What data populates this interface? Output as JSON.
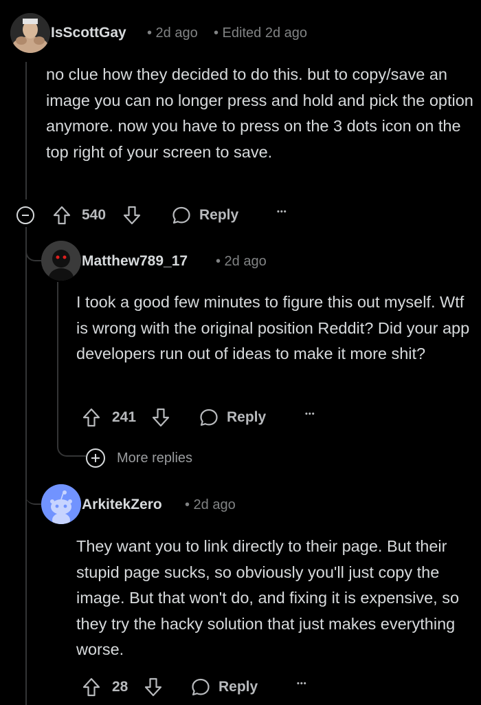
{
  "comments": [
    {
      "username": "IsScottGay",
      "age": "• 2d ago",
      "edited": "• Edited 2d ago",
      "body": "no clue how they decided to do this. but to copy/save an image you can no longer press and hold and pick the option anymore. now you have to press on the 3 dots icon on the top right of your screen to save.",
      "votes": "540",
      "reply_label": "Reply",
      "more_label": "•••"
    },
    {
      "username": "Matthew789_17",
      "age": "• 2d ago",
      "body": "I took a good few minutes to figure this out myself. Wtf is wrong with the original position Reddit? Did your app developers run out of ideas to make it more shit?",
      "votes": "241",
      "reply_label": "Reply",
      "more_label": "•••"
    },
    {
      "username": "ArkitekZero",
      "age": "• 2d ago",
      "body": "They want you to link directly to their page. But their stupid page sucks, so obviously you'll just copy the image. But that won't do, and fixing it is expensive, so they try the hacky solution that just makes everything worse.",
      "votes": "28",
      "reply_label": "Reply",
      "more_label": "•••"
    }
  ],
  "more_replies_label": "More replies",
  "colors": {
    "background": "#000000",
    "text": "#d7dadc",
    "meta": "#818384",
    "thread_line": "#343536",
    "default_avatar": "#7193ff"
  }
}
